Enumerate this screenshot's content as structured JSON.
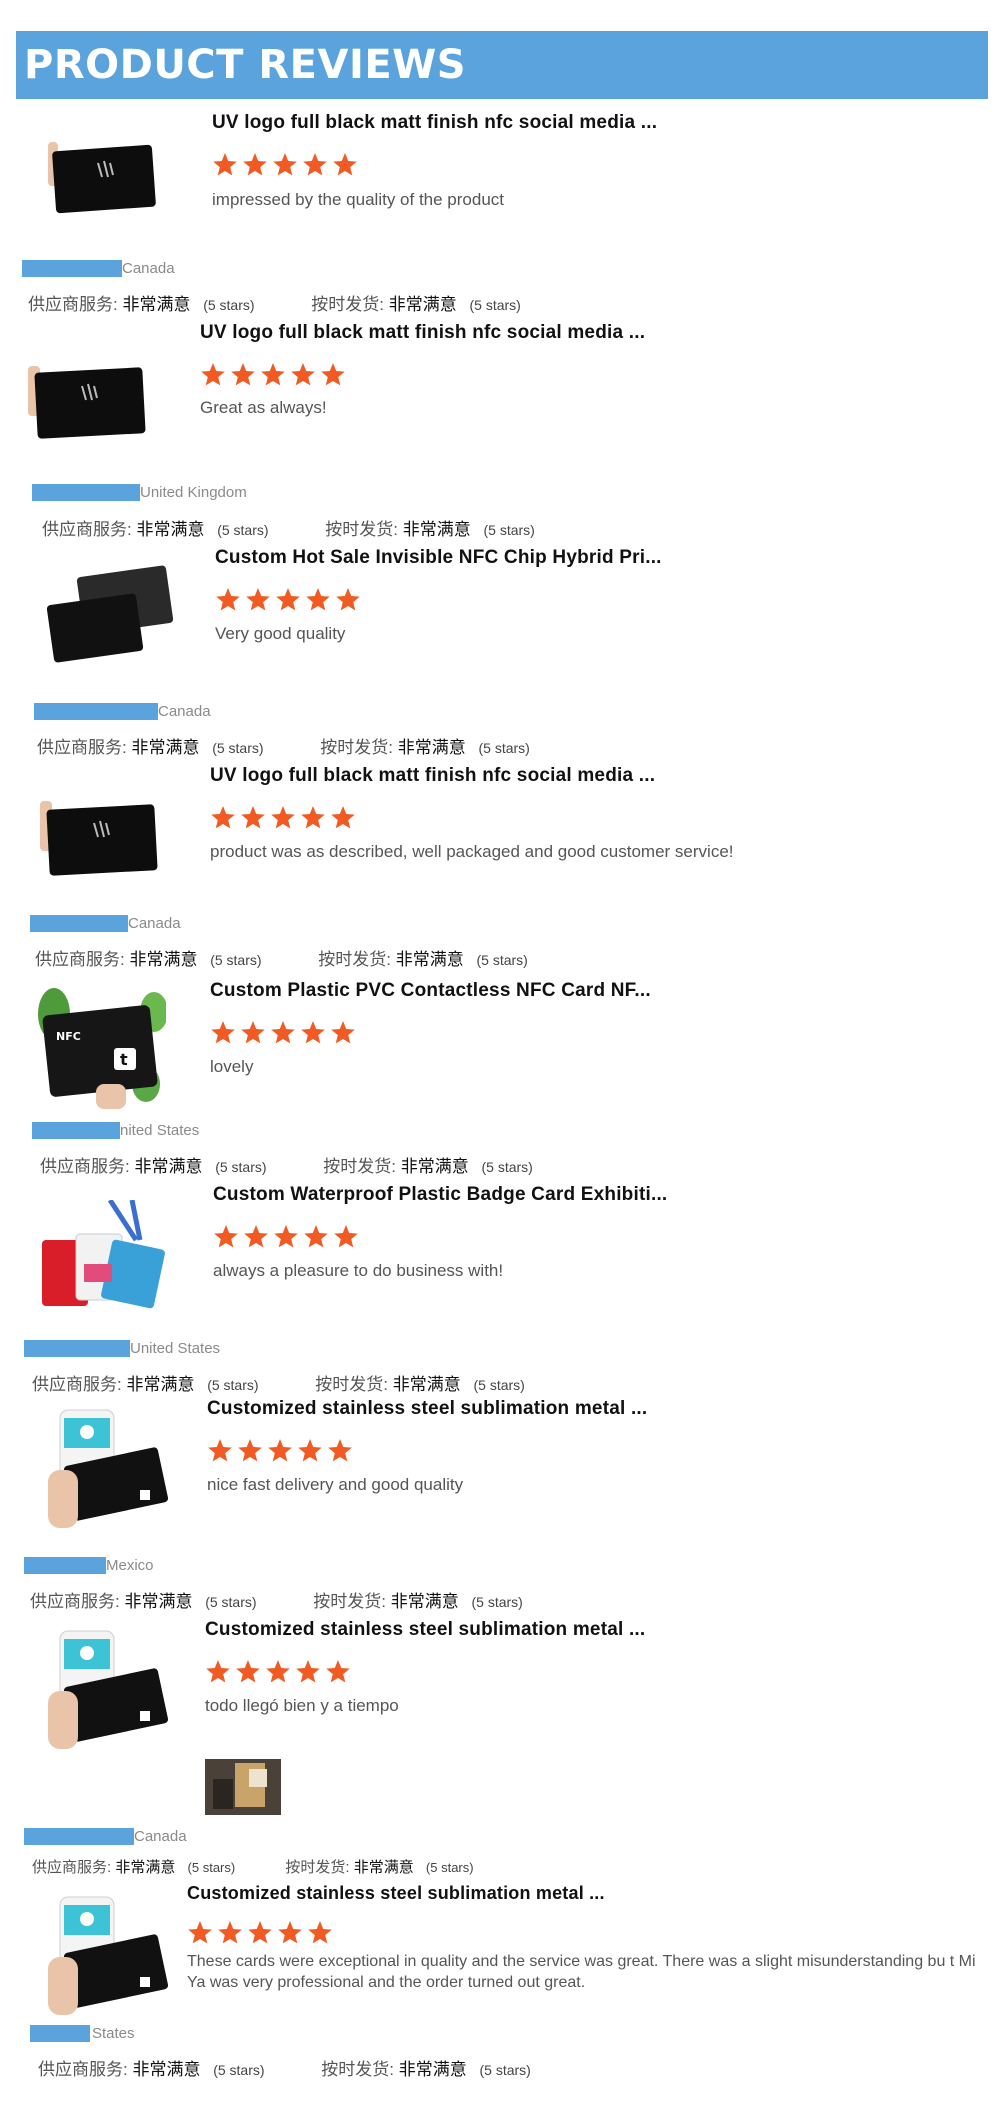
{
  "header": {
    "title": "PRODUCT REVIEWS"
  },
  "colors": {
    "accent": "#5ba3dc",
    "star": "#f15a22"
  },
  "rating_labels": {
    "supplier_service": "供应商服务:",
    "on_time_shipment": "按时发货:",
    "value": "非常满意",
    "count": "(5 stars)"
  },
  "reviews": [
    {
      "title": "UV logo full black matt finish nfc social media ...",
      "stars": 5,
      "comment": "impressed by the quality of the product",
      "country": "Canada",
      "image": "black-card-icon"
    },
    {
      "title": "UV logo full black matt finish nfc social media ...",
      "stars": 5,
      "comment": "Great as always!",
      "country": "United Kingdom",
      "image": "black-card-icon"
    },
    {
      "title": "Custom Hot Sale Invisible NFC Chip Hybrid Pri...",
      "stars": 5,
      "comment": "Very good quality",
      "country": "Canada",
      "image": "two-black-cards-icon"
    },
    {
      "title": "UV logo full black matt finish nfc social media ...",
      "stars": 5,
      "comment": "product was as described, well packaged and good customer service!",
      "country": "Canada",
      "image": "black-card-icon"
    },
    {
      "title": "Custom Plastic PVC Contactless NFC Card NF...",
      "stars": 5,
      "comment": "lovely",
      "country": "nited States",
      "image": "nfc-card-plant-icon"
    },
    {
      "title": "Custom Waterproof Plastic Badge Card Exhibiti...",
      "stars": 5,
      "comment": "always a pleasure to do business with!",
      "country": "United States",
      "image": "badge-cards-icon"
    },
    {
      "title": "Customized stainless steel sublimation metal ...",
      "stars": 5,
      "comment": "nice fast delivery and good quality",
      "country": "Mexico",
      "image": "phone-card-icon"
    },
    {
      "title": "Customized stainless steel sublimation metal ...",
      "stars": 5,
      "comment": "todo llegó bien y a tiempo",
      "country": "Canada",
      "image": "phone-card-icon",
      "has_photo": true
    },
    {
      "title": "Customized stainless steel sublimation metal ...",
      "stars": 5,
      "comment": "These cards were exceptional in quality and the service was great. There was a slight misunderstanding bu t Mi Ya was very professional and the order turned out great.",
      "country": "States",
      "image": "phone-card-icon"
    }
  ]
}
